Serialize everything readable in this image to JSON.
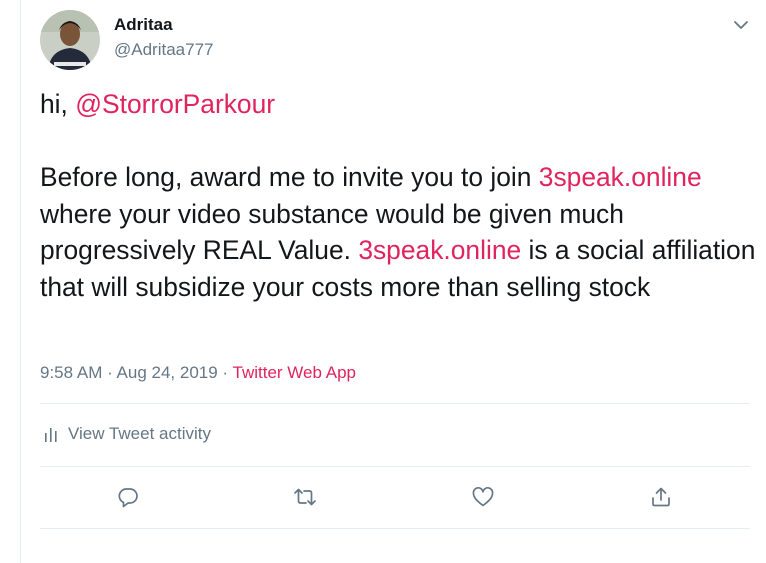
{
  "author": {
    "name": "Adritaa",
    "handle": "@Adritaa777"
  },
  "tweet": {
    "greeting": "hi, ",
    "mention": "@StorrorParkour",
    "p1": "Before long, award me to invite you to join ",
    "link1": "3speak.online",
    "p2": " where your video substance would be given much progressively REAL Value. ",
    "link2": "3speak.online",
    "p3": " is a social affiliation that will subsidize your costs more than selling stock"
  },
  "meta": {
    "time": "9:58 AM",
    "sep1": " · ",
    "date": "Aug 24, 2019",
    "sep2": " · ",
    "source": "Twitter Web App"
  },
  "activity": {
    "label": "View Tweet activity"
  },
  "icons": {
    "more": "chevron-down-icon",
    "activity": "bar-chart-icon",
    "reply": "reply-icon",
    "retweet": "retweet-icon",
    "like": "heart-icon",
    "share": "share-icon"
  },
  "colors": {
    "accent": "#e0245e",
    "secondary_text": "#657786",
    "primary_text": "#14171a",
    "divider": "#e6ecf0"
  }
}
